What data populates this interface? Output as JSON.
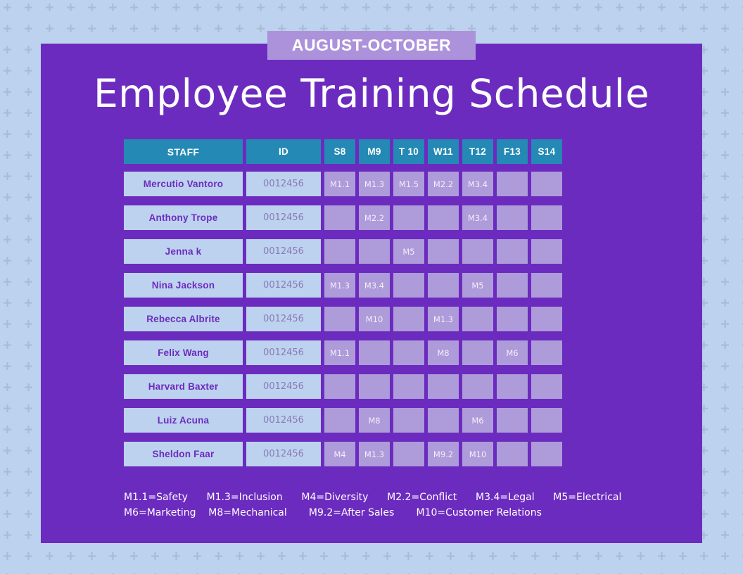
{
  "background": {
    "color": "#bdd2ee",
    "pattern_icon": "plus-icon",
    "pattern_color": "#a9bcd6"
  },
  "banner": {
    "label": "AUGUST-OCTOBER",
    "background": "#ac92da"
  },
  "title": "Employee Training Schedule",
  "card": {
    "background": "#6c2bbf"
  },
  "colors": {
    "purple": "#6c2bbf",
    "teal": "#2489b4",
    "light_blue": "#bdd2ee",
    "lavender": "#ae9bd9",
    "banner_purple": "#ac92da"
  },
  "table": {
    "headers": [
      "STAFF",
      "ID",
      "S8",
      "M9",
      "T 10",
      "W11",
      "T12",
      "F13",
      "S14"
    ],
    "rows": [
      {
        "staff": "Mercutio Vantoro",
        "id": "0012456",
        "days": [
          "M1.1",
          "M1.3",
          "M1.5",
          "M2.2",
          "M3.4",
          "",
          ""
        ]
      },
      {
        "staff": "Anthony Trope",
        "id": "0012456",
        "days": [
          "",
          "M2.2",
          "",
          "",
          "M3.4",
          "",
          ""
        ]
      },
      {
        "staff": "Jenna k",
        "id": "0012456",
        "days": [
          "",
          "",
          "M5",
          "",
          "",
          "",
          ""
        ]
      },
      {
        "staff": "Nina Jackson",
        "id": "0012456",
        "days": [
          "M1.3",
          "M3.4",
          "",
          "",
          "M5",
          "",
          ""
        ]
      },
      {
        "staff": "Rebecca Albrite",
        "id": "0012456",
        "days": [
          "",
          "M10",
          "",
          "M1.3",
          "",
          "",
          ""
        ]
      },
      {
        "staff": "Felix Wang",
        "id": "0012456",
        "days": [
          "M1.1",
          "",
          "",
          "M8",
          "",
          "M6",
          ""
        ]
      },
      {
        "staff": "Harvard Baxter",
        "id": "0012456",
        "days": [
          "",
          "",
          "",
          "",
          "",
          "",
          ""
        ]
      },
      {
        "staff": "Luiz Acuna",
        "id": "0012456",
        "days": [
          "",
          "M8",
          "",
          "",
          "M6",
          "",
          ""
        ]
      },
      {
        "staff": "Sheldon Faar",
        "id": "0012456",
        "days": [
          "M4",
          "M1.3",
          "",
          "M9.2",
          "M10",
          "",
          ""
        ]
      }
    ]
  },
  "legend": {
    "line1": "M1.1=Safety      M1.3=Inclusion      M4=Diversity      M2.2=Conflict      M3.4=Legal      M5=Electrical",
    "line2": "M6=Marketing    M8=Mechanical       M9.2=After Sales       M10=Customer Relations",
    "entries": [
      {
        "code": "M1.1",
        "meaning": "Safety"
      },
      {
        "code": "M1.3",
        "meaning": "Inclusion"
      },
      {
        "code": "M4",
        "meaning": "Diversity"
      },
      {
        "code": "M2.2",
        "meaning": "Conflict"
      },
      {
        "code": "M3.4",
        "meaning": "Legal"
      },
      {
        "code": "M5",
        "meaning": "Electrical"
      },
      {
        "code": "M6",
        "meaning": "Marketing"
      },
      {
        "code": "M8",
        "meaning": "Mechanical"
      },
      {
        "code": "M9.2",
        "meaning": "After Sales"
      },
      {
        "code": "M10",
        "meaning": "Customer Relations"
      }
    ]
  }
}
